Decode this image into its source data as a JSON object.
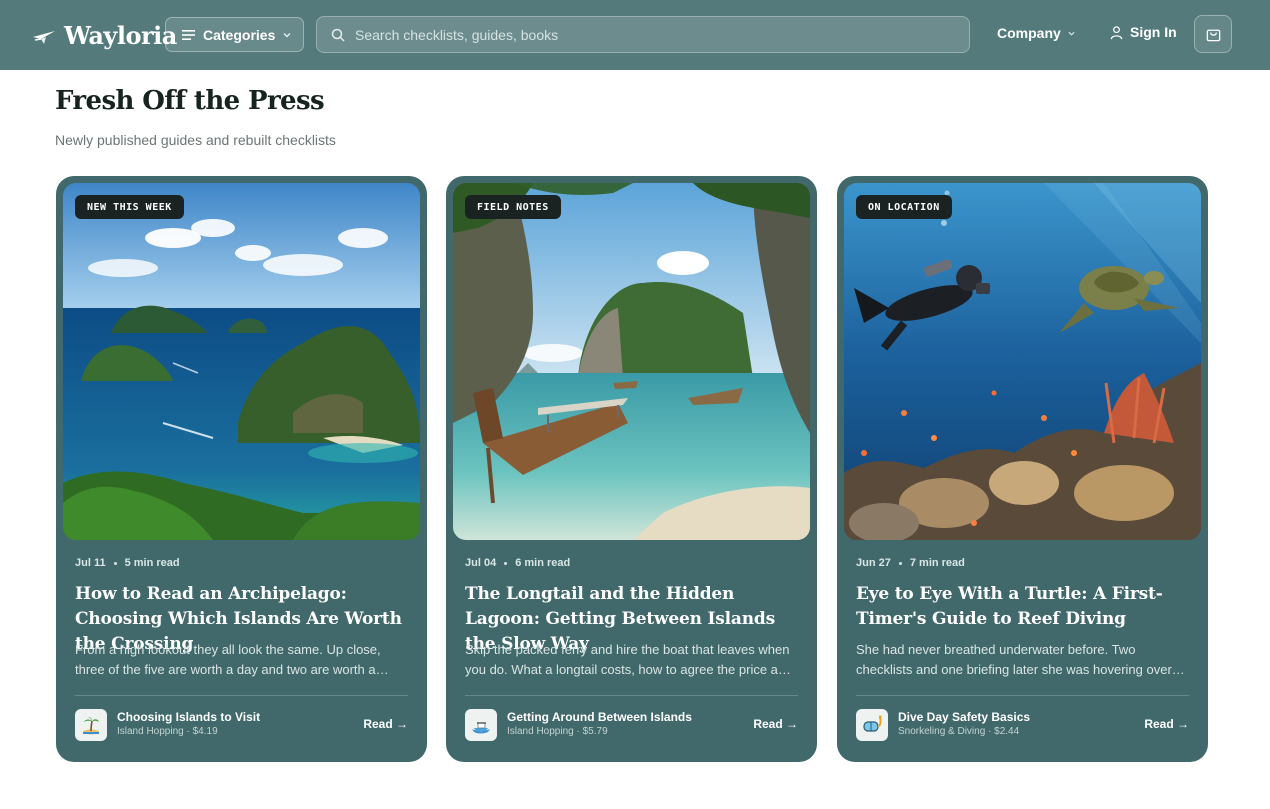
{
  "brand": {
    "name": "Wayloria",
    "logo_icon": "paper-plane-icon"
  },
  "header": {
    "categories_label": "Categories",
    "search_placeholder": "Search checklists, guides, books",
    "company_label": "Company",
    "signin_label": "Sign In",
    "cart_icon": "shopping-bag-icon"
  },
  "section": {
    "title": "Fresh Off the Press",
    "subtitle": "Newly published guides and rebuilt checklists"
  },
  "colors": {
    "header_bg": "#557a7b",
    "card_bg": "#41696b",
    "badge_bg": "#1b2322"
  },
  "cards": [
    {
      "badge": "NEW THIS WEEK",
      "date": "Jul 11",
      "read_time": "5 min read",
      "title": "How to Read an Archipelago: Choosing Which Islands Are Worth the Crossing",
      "excerpt": "From a high lookout they all look the same. Up close, three of the five are worth a day and two are worth a week. Here is how to tell them apart.",
      "product_name": "Choosing Islands to Visit",
      "product_meta": "Island Hopping · $4.19",
      "product_icon": "palm-island-icon",
      "cta": "Read →"
    },
    {
      "badge": "FIELD NOTES",
      "date": "Jul 04",
      "read_time": "6 min read",
      "title": "The Longtail and the Hidden Lagoon: Getting Between Islands the Slow Way",
      "excerpt": "Skip the packed ferry and hire the boat that leaves when you do. What a longtail costs, how to agree the price and when to go.",
      "product_name": "Getting Around Between Islands",
      "product_meta": "Island Hopping · $5.79",
      "product_icon": "boat-icon",
      "cta": "Read →"
    },
    {
      "badge": "ON LOCATION",
      "date": "Jun 27",
      "read_time": "7 min read",
      "title": "Eye to Eye With a Turtle: A First-Timer's Guide to Reef Diving",
      "excerpt": "She had never breathed underwater before. Two checklists and one briefing later she was hovering over the reef beside a turtle.",
      "product_name": "Dive Day Safety Basics",
      "product_meta": "Snorkeling & Diving · $2.44",
      "product_icon": "diving-mask-icon",
      "cta": "Read →"
    }
  ]
}
